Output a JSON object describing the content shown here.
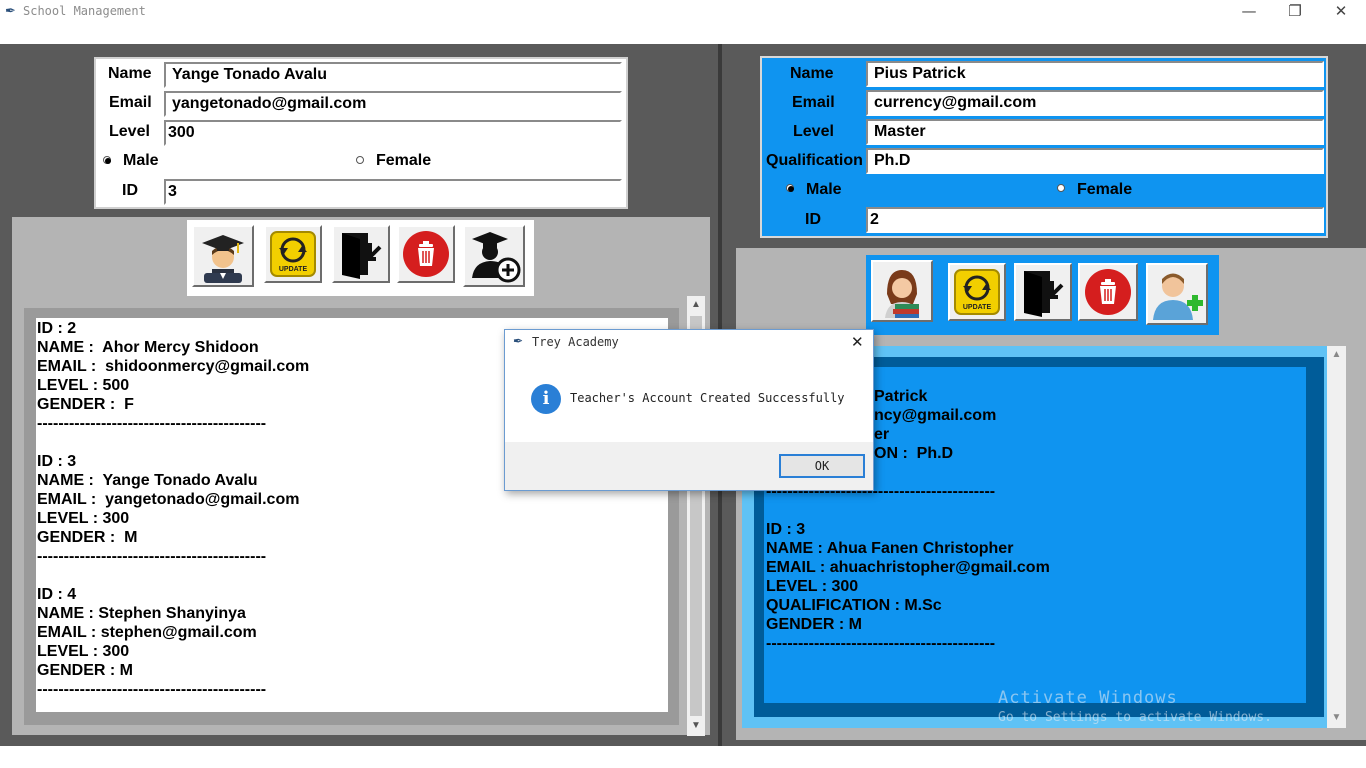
{
  "window": {
    "title": "School Management",
    "controls": {
      "minimize": "—",
      "restore": "❐",
      "close": "✕"
    }
  },
  "student_form": {
    "name_label": "Name",
    "name_value": "Yange Tonado Avalu",
    "email_label": "Email",
    "email_value": "yangetonado@gmail.com",
    "level_label": "Level",
    "level_value": "300",
    "gender_male": "Male",
    "gender_female": "Female",
    "gender_selected": "Male",
    "id_label": "ID",
    "id_value": "3"
  },
  "student_toolbar": {
    "icons": [
      "graduate-student-icon",
      "update-icon",
      "exit-door-icon",
      "delete-bin-icon",
      "add-student-icon"
    ],
    "update_text": "UPDATE"
  },
  "student_records": [
    {
      "id": "ID : 2",
      "name": "NAME :  Ahor Mercy Shidoon",
      "email": "EMAIL :  shidoonmercy@gmail.com",
      "level": "LEVEL : 500",
      "gender": "GENDER :  F",
      "sep": "-------------------------------------------"
    },
    {
      "id": "ID : 3",
      "name": "NAME :  Yange Tonado Avalu",
      "email": "EMAIL :  yangetonado@gmail.com",
      "level": "LEVEL : 300",
      "gender": "GENDER :  M",
      "sep": "-------------------------------------------"
    },
    {
      "id": "ID : 4",
      "name": "NAME : Stephen Shanyinya",
      "email": "EMAIL : stephen@gmail.com",
      "level": "LEVEL : 300",
      "gender": "GENDER : M",
      "sep": "-------------------------------------------"
    }
  ],
  "teacher_form": {
    "name_label": "Name",
    "name_value": "Pius Patrick",
    "email_label": "Email",
    "email_value": "currency@gmail.com",
    "level_label": "Level",
    "level_value": "Master",
    "qualification_label": "Qualification",
    "qualification_value": "Ph.D",
    "gender_male": "Male",
    "gender_female": "Female",
    "gender_selected": "Male",
    "id_label": "ID",
    "id_value": "2"
  },
  "teacher_toolbar": {
    "icons": [
      "teacher-icon",
      "update-icon",
      "exit-door-icon",
      "delete-bin-icon",
      "add-teacher-icon"
    ],
    "update_text": "UPDATE"
  },
  "teacher_records_partial": {
    "line1": "Patrick",
    "line2": "ncy@gmail.com",
    "line3": "er",
    "line4": "ON :  Ph.D",
    "sep": "-------------------------------------------"
  },
  "teacher_records": [
    {
      "id": "ID : 3",
      "name": "NAME : Ahua Fanen Christopher",
      "email": "EMAIL : ahuachristopher@gmail.com",
      "level": "LEVEL : 300",
      "qualification": "QUALIFICATION : M.Sc",
      "gender": "GENDER : M",
      "sep": "-------------------------------------------"
    }
  ],
  "dialog": {
    "title": "Trey Academy",
    "message": "Teacher's Account Created Successfully",
    "ok": "OK",
    "close": "✕",
    "info_glyph": "i"
  },
  "watermark": {
    "line1": "Activate Windows",
    "line2": "Go to Settings to activate Windows."
  },
  "colors": {
    "app_bg": "#5a5a5a",
    "teacher_blue": "#0f94f0",
    "teacher_frame_dark": "#005c99",
    "teacher_frame_light": "#5fc2f5",
    "dialog_border": "#6b9bd1"
  }
}
